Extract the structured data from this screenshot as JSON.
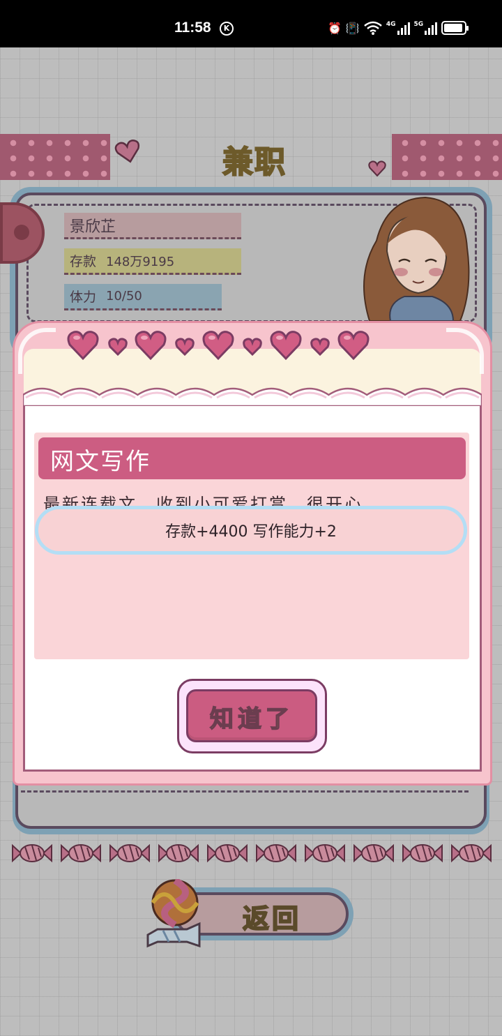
{
  "status_bar": {
    "time": "11:58",
    "time_badge": "K",
    "icons": [
      "alarm-icon",
      "vibrate-icon",
      "wifi-icon",
      "4g-signal-icon",
      "5g-signal-icon",
      "battery-icon"
    ],
    "signal_4g_label": "4G",
    "signal_5g_label": "5G"
  },
  "header": {
    "title": "兼职"
  },
  "profile": {
    "name": "景欣芷",
    "money_label": "存款",
    "money_value": "148万9195",
    "stamina_label": "体力",
    "stamina_value": "10/50"
  },
  "modal": {
    "title": "网文写作",
    "description": "最新连载文，收到小可爱打赏，很开心",
    "reward": "存款+4400 写作能力+2",
    "confirm_label": "知道了"
  },
  "footer": {
    "back_label": "返回"
  },
  "colors": {
    "modal_pink": "#f7c4cd",
    "title_bar": "#cc5d82",
    "reward_border": "#b3def5",
    "button_text": "#f2e06a"
  }
}
